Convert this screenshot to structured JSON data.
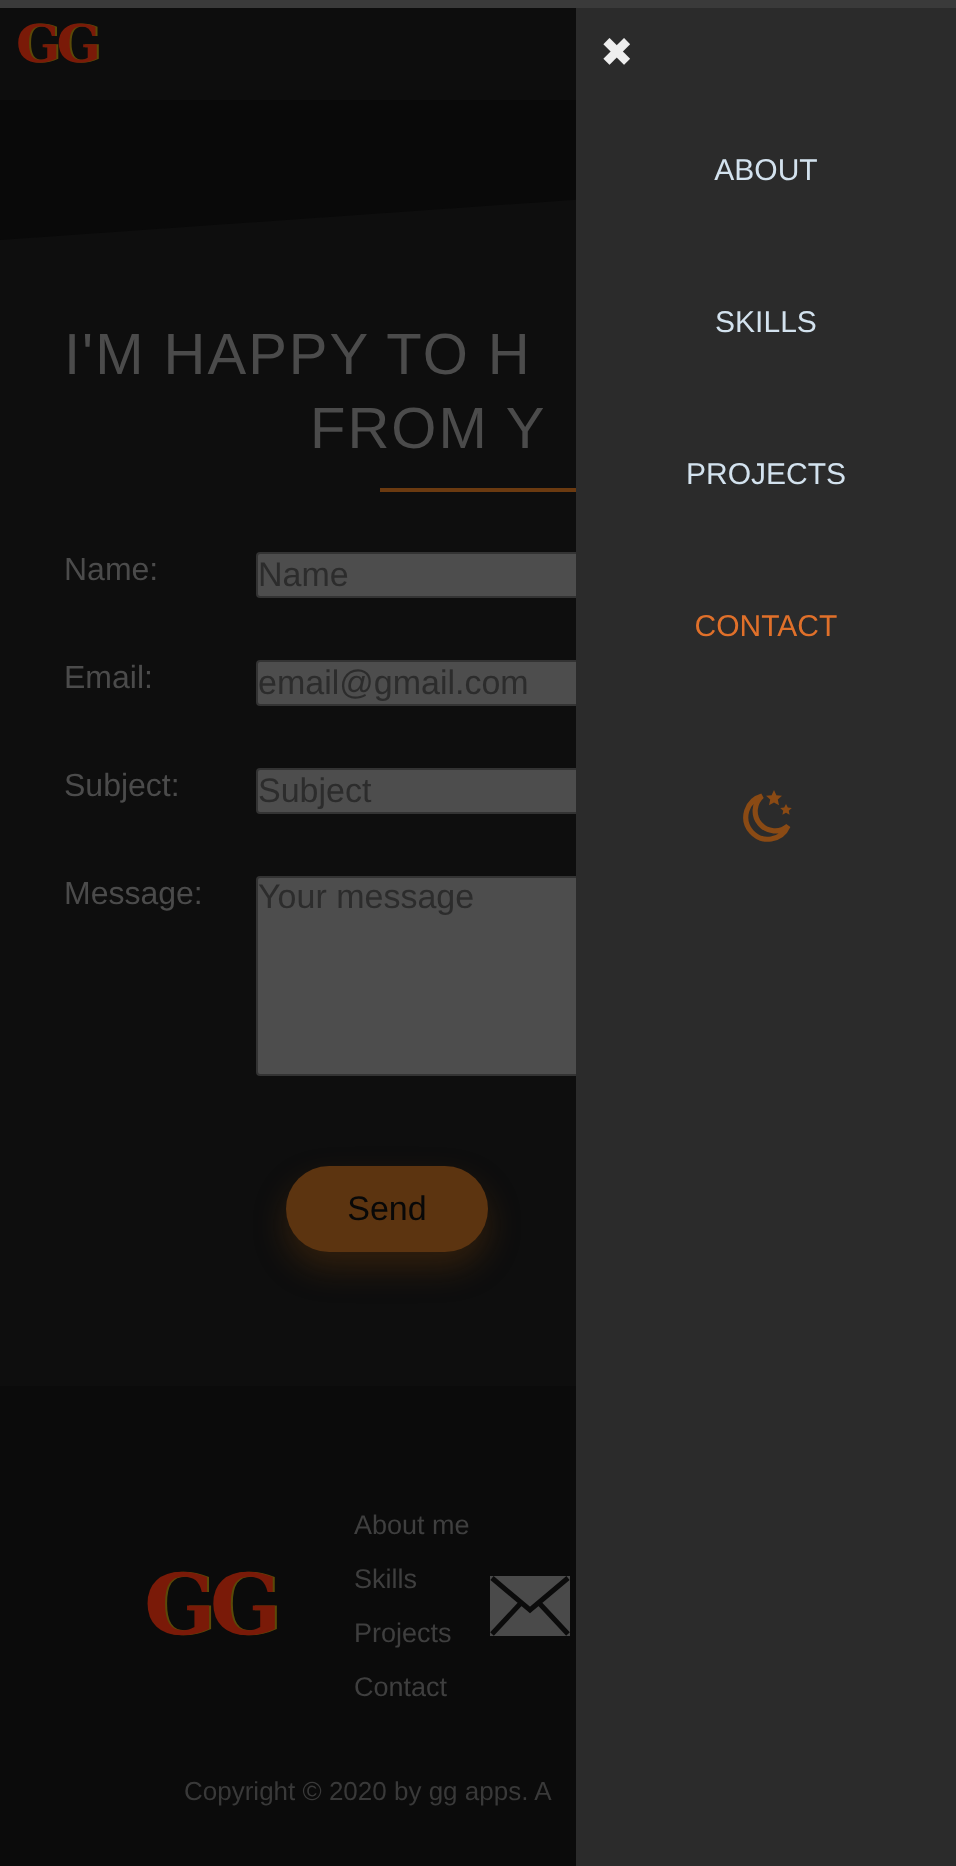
{
  "header": {
    "logo": "GG"
  },
  "contact": {
    "heading_lines": [
      "I'M HAPPY TO H",
      "FROM Y"
    ],
    "fields": [
      {
        "label": "Name:",
        "placeholder": "Name",
        "kind": "input"
      },
      {
        "label": "Email:",
        "placeholder": "email@gmail.com",
        "kind": "input"
      },
      {
        "label": "Subject:",
        "placeholder": "Subject",
        "kind": "input"
      },
      {
        "label": "Message:",
        "placeholder": "Your message",
        "kind": "textarea"
      }
    ],
    "send_button": "Send"
  },
  "footer": {
    "logo": "GG",
    "links": [
      "About me",
      "Skills",
      "Projects",
      "Contact"
    ],
    "copyright": "Copyright © 2020 by gg apps. A"
  },
  "drawer": {
    "close": "✖",
    "items": [
      {
        "label": "ABOUT",
        "selected": false
      },
      {
        "label": "SKILLS",
        "selected": false
      },
      {
        "label": "PROJECTS",
        "selected": false
      },
      {
        "label": "CONTACT",
        "selected": true
      }
    ]
  }
}
